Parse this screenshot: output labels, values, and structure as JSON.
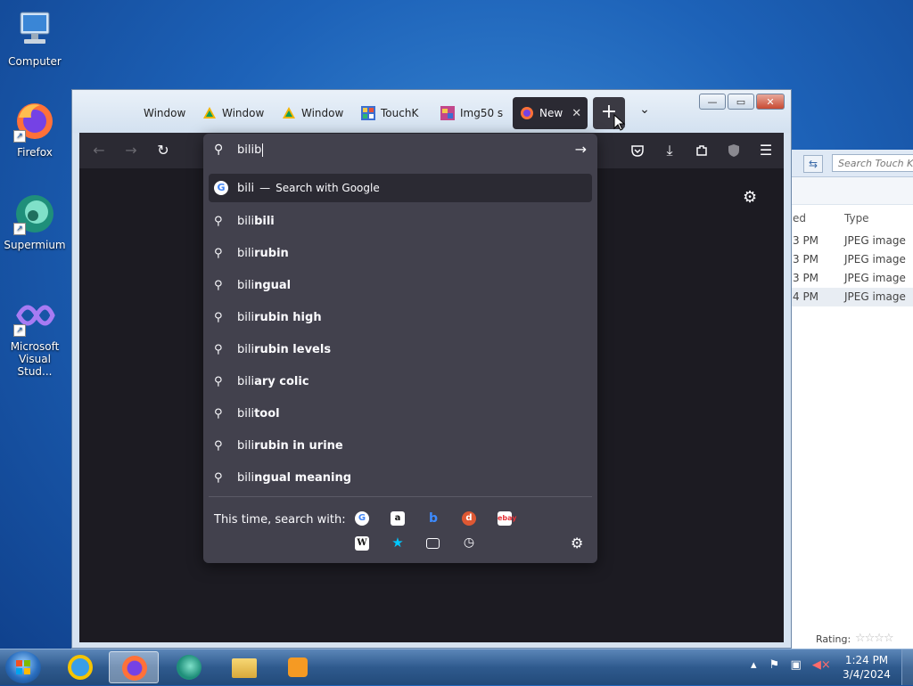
{
  "desktop": {
    "icons": [
      {
        "label": "Computer"
      },
      {
        "label": "Firefox"
      },
      {
        "label": "Supermium"
      },
      {
        "label": "Microsoft Visual Stud..."
      }
    ]
  },
  "explorer": {
    "search_placeholder": "Search Touch Ke",
    "columns": [
      "ed",
      "Type"
    ],
    "rows": [
      {
        "time": "3 PM",
        "type": "JPEG image"
      },
      {
        "time": "3 PM",
        "type": "JPEG image"
      },
      {
        "time": "3 PM",
        "type": "JPEG image"
      },
      {
        "time": "4 PM",
        "type": "JPEG image"
      }
    ],
    "rating_label": "Rating:"
  },
  "browser": {
    "tabs": [
      {
        "title": "Window"
      },
      {
        "title": "Window"
      },
      {
        "title": "Window"
      },
      {
        "title": "TouchK"
      },
      {
        "title": "Img50 s"
      },
      {
        "title": "New"
      }
    ],
    "close_tab_glyph": "✕",
    "new_tab_glyph": "+",
    "list_tabs_glyph": "⌄",
    "window_buttons": {
      "minimize": "—",
      "maximize": "▭",
      "close": "✕"
    }
  },
  "urlbar": {
    "query": "bilib",
    "first": {
      "typed": "bili",
      "separator": "—",
      "action": "Search with Google"
    },
    "suggestions": [
      {
        "prefix": "bili",
        "rest": "bili"
      },
      {
        "prefix": "bili",
        "rest": "rubin"
      },
      {
        "prefix": "bili",
        "rest": "ngual"
      },
      {
        "prefix": "bili",
        "rest": "rubin high"
      },
      {
        "prefix": "bili",
        "rest": "rubin levels"
      },
      {
        "prefix": "bili",
        "rest": "ary colic"
      },
      {
        "prefix": "bili",
        "rest": "tool"
      },
      {
        "prefix": "bili",
        "rest": "rubin in urine"
      },
      {
        "prefix": "bili",
        "rest": "ngual meaning"
      }
    ],
    "search_with_label": "This time, search with:",
    "engines": [
      "google-engine-icon",
      "amazon-engine-icon",
      "bing-engine-icon",
      "duckduckgo-engine-icon",
      "ebay-engine-icon",
      "wikipedia-engine-icon",
      "bookmarks-icon",
      "tabs-icon",
      "history-icon"
    ]
  },
  "taskbar": {
    "time": "1:24 PM",
    "date": "3/4/2024"
  },
  "colors": {
    "browser_dark": "#2b2a33",
    "popup": "#42414d",
    "content": "#1c1b22"
  }
}
